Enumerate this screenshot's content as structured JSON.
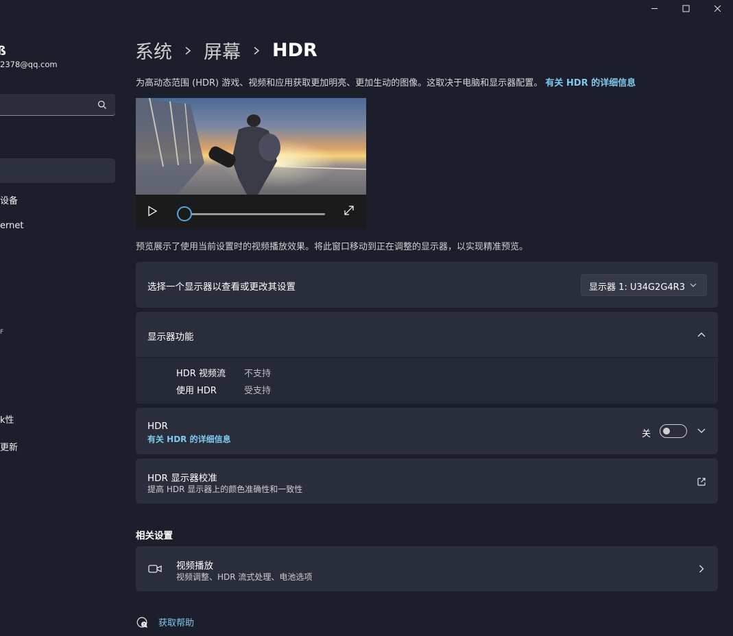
{
  "window": {
    "controls": [
      "minimize",
      "maximize",
      "close"
    ]
  },
  "sidebar": {
    "user_name": "ß",
    "user_email": "2378@qq.com",
    "items": [
      "设备",
      "ernet",
      "F",
      "k性",
      "更新"
    ]
  },
  "breadcrumb": {
    "level1": "系统",
    "level2": "屏幕",
    "current": "HDR"
  },
  "intro": {
    "text": "为高动态范围 (HDR) 游戏、视频和应用获取更加明亮、更加生动的图像。这取决于电脑和显示器配置。",
    "link": "有关 HDR 的详细信息"
  },
  "video": {
    "progress": 0
  },
  "preview_note": "预览展示了使用当前设置时的视频播放效果。将此窗口移动到正在调整的显示器，以实现精准预览。",
  "display_select": {
    "label": "选择一个显示器以查看或更改其设置",
    "selected": "显示器 1: U34G2G4R3"
  },
  "display_features": {
    "title": "显示器功能",
    "rows": [
      {
        "label": "HDR 视频流",
        "value": "不支持"
      },
      {
        "label": "使用 HDR",
        "value": "受支持"
      }
    ]
  },
  "hdr": {
    "title": "HDR",
    "link": "有关 HDR 的详细信息",
    "toggle_state": "关",
    "enabled": false
  },
  "calibration": {
    "title": "HDR 显示器校准",
    "subtitle": "提高 HDR 显示器上的颜色准确性和一致性"
  },
  "related": {
    "heading": "相关设置",
    "video_playback": {
      "title": "视频播放",
      "subtitle": "视频调整、HDR 流式处理、电池选项"
    }
  },
  "help": {
    "label": "获取帮助"
  },
  "colors": {
    "background": "#1c1f2b",
    "card": "#2a2d3b",
    "accent": "#7fc9ee",
    "seek": "#4fa8dc"
  }
}
